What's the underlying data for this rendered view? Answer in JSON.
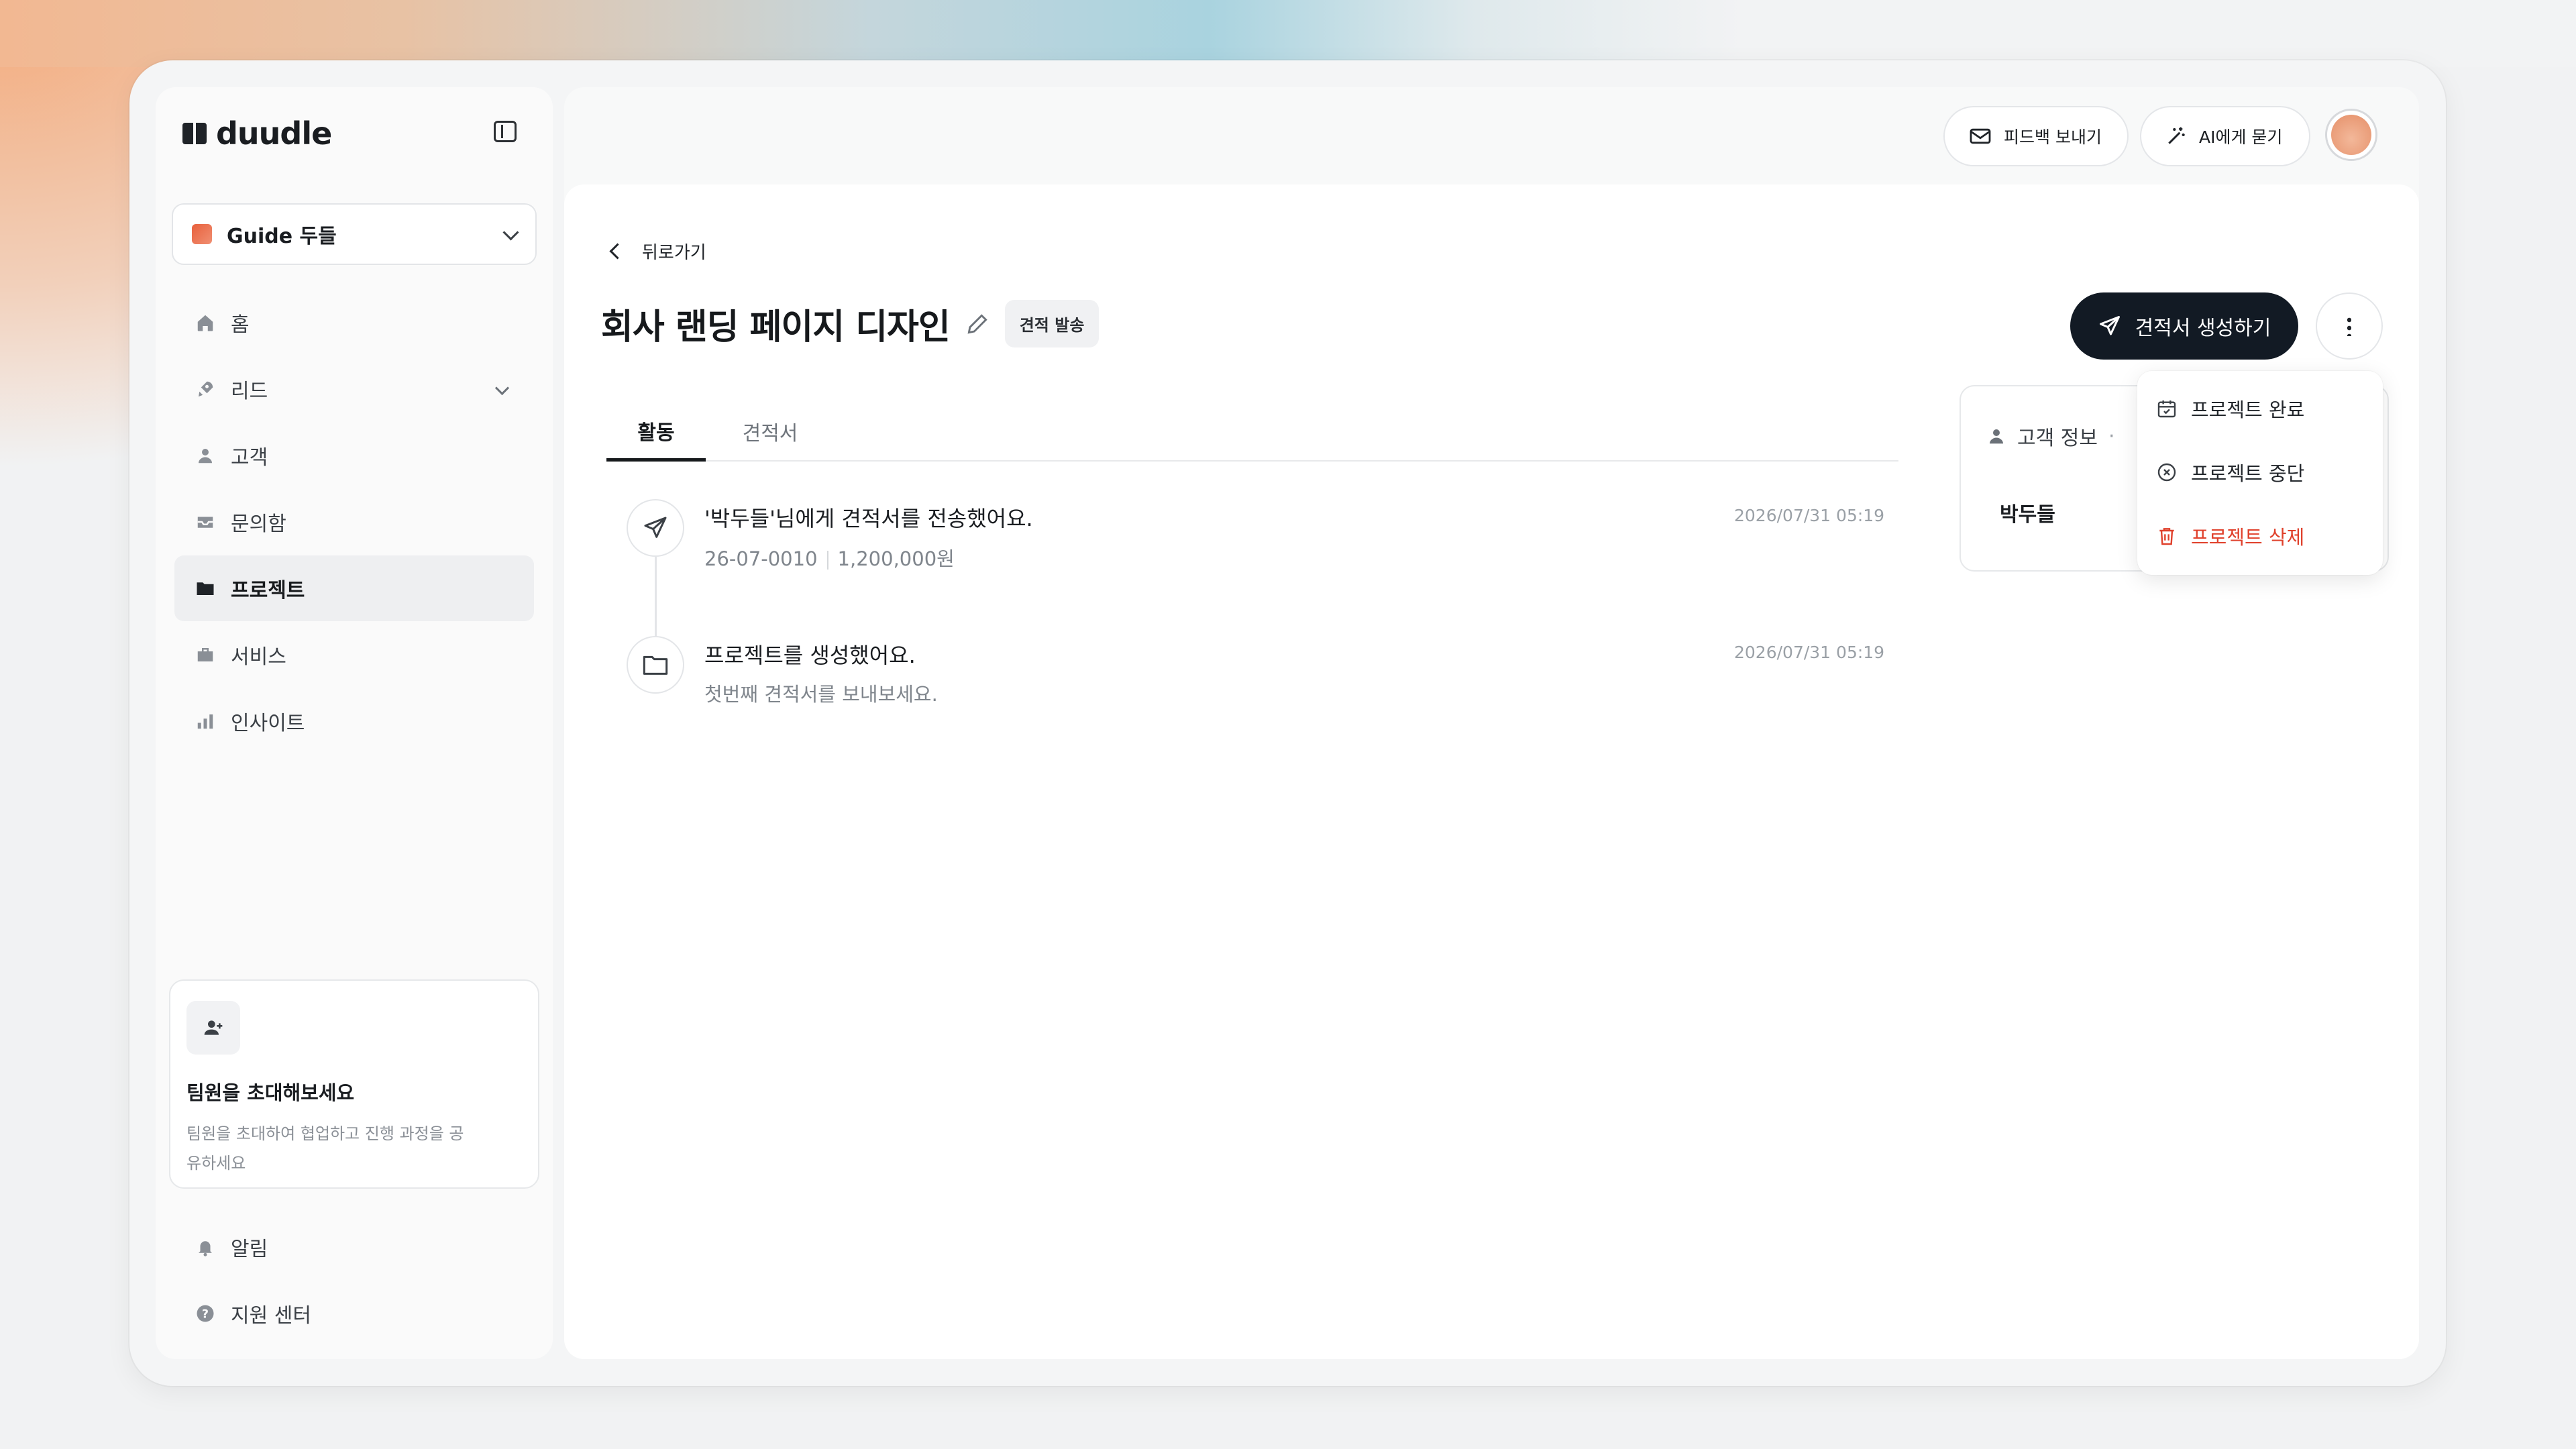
{
  "app": {
    "name": "duudle"
  },
  "workspace": {
    "label": "Guide 두들"
  },
  "sidebar": {
    "items": [
      {
        "label": "홈",
        "icon": "home-icon"
      },
      {
        "label": "리드",
        "icon": "rocket-icon"
      },
      {
        "label": "고객",
        "icon": "user-icon"
      },
      {
        "label": "문의함",
        "icon": "inbox-icon"
      },
      {
        "label": "프로젝트",
        "icon": "folder-icon",
        "active": true
      },
      {
        "label": "서비스",
        "icon": "briefcase-icon"
      },
      {
        "label": "인사이트",
        "icon": "chart-bar-icon"
      }
    ],
    "bottom": [
      {
        "label": "알림",
        "icon": "bell-icon"
      },
      {
        "label": "지원 센터",
        "icon": "help-icon"
      }
    ],
    "invite": {
      "title": "팀원을 초대해보세요",
      "description": "팀원을 초대하여 협업하고 진행 과정을 공유하세요"
    }
  },
  "header": {
    "feedback_label": "피드백 보내기",
    "ai_label": "AI에게 묻기"
  },
  "project": {
    "back_label": "뒤로가기",
    "title": "회사 랜딩 페이지 디자인",
    "status_badge": "견적 발송",
    "create_quote_label": "견적서 생성하기"
  },
  "tabs": [
    {
      "label": "활동",
      "active": true
    },
    {
      "label": "견적서",
      "active": false
    }
  ],
  "activities": [
    {
      "icon": "send-icon",
      "title": "'박두들'님에게 견적서를 전송했어요.",
      "quote_no": "26-07-0010",
      "amount": "1,200,000원",
      "date": "2026/07/31 05:19"
    },
    {
      "icon": "folder-icon",
      "title": "프로젝트를 생성했어요.",
      "subtitle": "첫번째 견적서를 보내보세요.",
      "date": "2026/07/31 05:19"
    }
  ],
  "customer_card": {
    "header": "고객 정보",
    "separator": "·",
    "name": "박두들"
  },
  "menu": {
    "items": [
      {
        "label": "프로젝트 완료",
        "icon": "calendar-check-icon"
      },
      {
        "label": "프로젝트 중단",
        "icon": "circle-x-icon"
      },
      {
        "label": "프로젝트 삭제",
        "icon": "trash-icon",
        "danger": true
      }
    ]
  },
  "colors": {
    "primary_button": "#121a24",
    "danger": "#e0412c",
    "active_nav": "#eeeff1"
  }
}
